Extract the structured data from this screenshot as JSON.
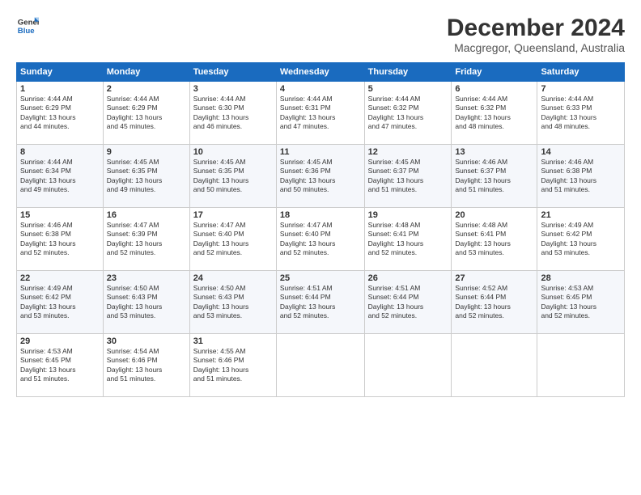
{
  "logo": {
    "line1": "General",
    "line2": "Blue"
  },
  "title": "December 2024",
  "subtitle": "Macgregor, Queensland, Australia",
  "header": {
    "days": [
      "Sunday",
      "Monday",
      "Tuesday",
      "Wednesday",
      "Thursday",
      "Friday",
      "Saturday"
    ]
  },
  "weeks": [
    [
      {
        "day": "1",
        "info": "Sunrise: 4:44 AM\nSunset: 6:29 PM\nDaylight: 13 hours\nand 44 minutes."
      },
      {
        "day": "2",
        "info": "Sunrise: 4:44 AM\nSunset: 6:29 PM\nDaylight: 13 hours\nand 45 minutes."
      },
      {
        "day": "3",
        "info": "Sunrise: 4:44 AM\nSunset: 6:30 PM\nDaylight: 13 hours\nand 46 minutes."
      },
      {
        "day": "4",
        "info": "Sunrise: 4:44 AM\nSunset: 6:31 PM\nDaylight: 13 hours\nand 47 minutes."
      },
      {
        "day": "5",
        "info": "Sunrise: 4:44 AM\nSunset: 6:32 PM\nDaylight: 13 hours\nand 47 minutes."
      },
      {
        "day": "6",
        "info": "Sunrise: 4:44 AM\nSunset: 6:32 PM\nDaylight: 13 hours\nand 48 minutes."
      },
      {
        "day": "7",
        "info": "Sunrise: 4:44 AM\nSunset: 6:33 PM\nDaylight: 13 hours\nand 48 minutes."
      }
    ],
    [
      {
        "day": "8",
        "info": "Sunrise: 4:44 AM\nSunset: 6:34 PM\nDaylight: 13 hours\nand 49 minutes."
      },
      {
        "day": "9",
        "info": "Sunrise: 4:45 AM\nSunset: 6:35 PM\nDaylight: 13 hours\nand 49 minutes."
      },
      {
        "day": "10",
        "info": "Sunrise: 4:45 AM\nSunset: 6:35 PM\nDaylight: 13 hours\nand 50 minutes."
      },
      {
        "day": "11",
        "info": "Sunrise: 4:45 AM\nSunset: 6:36 PM\nDaylight: 13 hours\nand 50 minutes."
      },
      {
        "day": "12",
        "info": "Sunrise: 4:45 AM\nSunset: 6:37 PM\nDaylight: 13 hours\nand 51 minutes."
      },
      {
        "day": "13",
        "info": "Sunrise: 4:46 AM\nSunset: 6:37 PM\nDaylight: 13 hours\nand 51 minutes."
      },
      {
        "day": "14",
        "info": "Sunrise: 4:46 AM\nSunset: 6:38 PM\nDaylight: 13 hours\nand 51 minutes."
      }
    ],
    [
      {
        "day": "15",
        "info": "Sunrise: 4:46 AM\nSunset: 6:38 PM\nDaylight: 13 hours\nand 52 minutes."
      },
      {
        "day": "16",
        "info": "Sunrise: 4:47 AM\nSunset: 6:39 PM\nDaylight: 13 hours\nand 52 minutes."
      },
      {
        "day": "17",
        "info": "Sunrise: 4:47 AM\nSunset: 6:40 PM\nDaylight: 13 hours\nand 52 minutes."
      },
      {
        "day": "18",
        "info": "Sunrise: 4:47 AM\nSunset: 6:40 PM\nDaylight: 13 hours\nand 52 minutes."
      },
      {
        "day": "19",
        "info": "Sunrise: 4:48 AM\nSunset: 6:41 PM\nDaylight: 13 hours\nand 52 minutes."
      },
      {
        "day": "20",
        "info": "Sunrise: 4:48 AM\nSunset: 6:41 PM\nDaylight: 13 hours\nand 53 minutes."
      },
      {
        "day": "21",
        "info": "Sunrise: 4:49 AM\nSunset: 6:42 PM\nDaylight: 13 hours\nand 53 minutes."
      }
    ],
    [
      {
        "day": "22",
        "info": "Sunrise: 4:49 AM\nSunset: 6:42 PM\nDaylight: 13 hours\nand 53 minutes."
      },
      {
        "day": "23",
        "info": "Sunrise: 4:50 AM\nSunset: 6:43 PM\nDaylight: 13 hours\nand 53 minutes."
      },
      {
        "day": "24",
        "info": "Sunrise: 4:50 AM\nSunset: 6:43 PM\nDaylight: 13 hours\nand 53 minutes."
      },
      {
        "day": "25",
        "info": "Sunrise: 4:51 AM\nSunset: 6:44 PM\nDaylight: 13 hours\nand 52 minutes."
      },
      {
        "day": "26",
        "info": "Sunrise: 4:51 AM\nSunset: 6:44 PM\nDaylight: 13 hours\nand 52 minutes."
      },
      {
        "day": "27",
        "info": "Sunrise: 4:52 AM\nSunset: 6:44 PM\nDaylight: 13 hours\nand 52 minutes."
      },
      {
        "day": "28",
        "info": "Sunrise: 4:53 AM\nSunset: 6:45 PM\nDaylight: 13 hours\nand 52 minutes."
      }
    ],
    [
      {
        "day": "29",
        "info": "Sunrise: 4:53 AM\nSunset: 6:45 PM\nDaylight: 13 hours\nand 51 minutes."
      },
      {
        "day": "30",
        "info": "Sunrise: 4:54 AM\nSunset: 6:46 PM\nDaylight: 13 hours\nand 51 minutes."
      },
      {
        "day": "31",
        "info": "Sunrise: 4:55 AM\nSunset: 6:46 PM\nDaylight: 13 hours\nand 51 minutes."
      },
      null,
      null,
      null,
      null
    ]
  ]
}
